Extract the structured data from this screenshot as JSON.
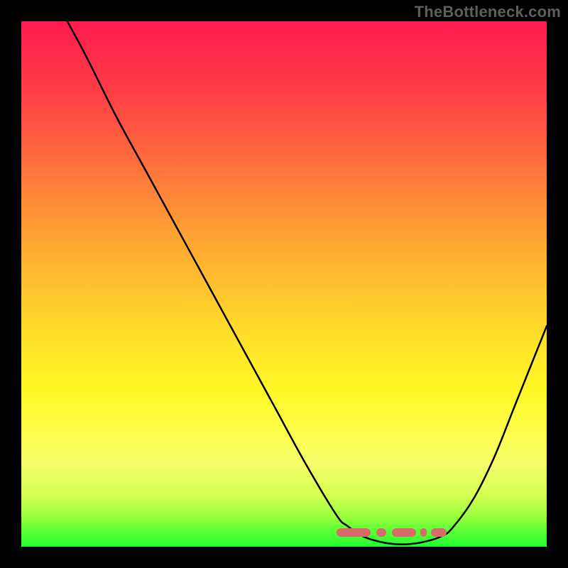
{
  "watermark": "TheBottleneck.com",
  "colors": {
    "background": "#000000",
    "watermark_text": "#5e5e5e",
    "curve": "#000000",
    "marker": "#d86a6a",
    "gradient_top": "#ff1a50",
    "gradient_bottom": "#1eff30"
  },
  "chart_data": {
    "type": "line",
    "title": "",
    "xlabel": "",
    "ylabel": "",
    "xlim": [
      0,
      100
    ],
    "ylim": [
      0,
      100
    ],
    "grid": false,
    "legend": false,
    "series": [
      {
        "name": "bottleneck-curve",
        "x": [
          0,
          6,
          12,
          18,
          24,
          30,
          36,
          42,
          48,
          54,
          60,
          62,
          65,
          68,
          71,
          74,
          77,
          80,
          82,
          86,
          90,
          94,
          98,
          100
        ],
        "y": [
          116,
          105,
          94,
          82,
          71,
          60,
          49,
          38,
          27,
          16,
          6,
          4,
          2,
          1,
          0.5,
          0.5,
          1,
          2,
          3.5,
          9,
          17,
          27,
          37,
          42
        ],
        "note": "y ≈ bottleneck percentage; values above 100 indicate the curve enters from above the visible top edge"
      }
    ],
    "annotations": [
      {
        "name": "optimal-range-marker",
        "style": "dashed-band",
        "y": 2,
        "x_start": 60,
        "x_end": 81
      }
    ]
  }
}
